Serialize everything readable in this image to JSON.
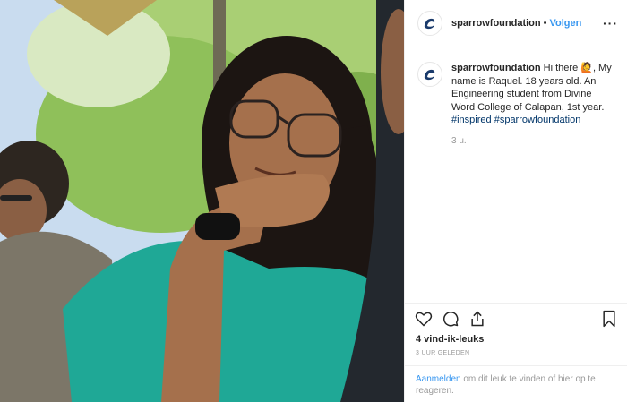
{
  "header": {
    "username": "sparrowfoundation",
    "separator": "•",
    "follow_label": "Volgen",
    "more_label": "···"
  },
  "caption": {
    "username": "sparrowfoundation",
    "text": "Hi there 🙋, My name is Raquel. 18 years old. An Engineering student from Divine Word College of Calapan, 1st year.",
    "hashtag1": "#inspired",
    "hashtag2": "#sparrowfoundation",
    "time": "3 u."
  },
  "actions": {
    "like_icon": "heart-icon",
    "comment_icon": "comment-icon",
    "share_icon": "share-icon",
    "save_icon": "bookmark-icon"
  },
  "stats": {
    "likes": "4 vind-ik-leuks",
    "posted_ago": "3 UUR GELEDEN"
  },
  "login_prompt": {
    "link": "Aanmelden",
    "text": " om dit leuk te vinden of hier op te reageren."
  },
  "colors": {
    "link_blue": "#3897f0",
    "hashtag": "#003569",
    "shirt_teal": "#1fa896"
  }
}
